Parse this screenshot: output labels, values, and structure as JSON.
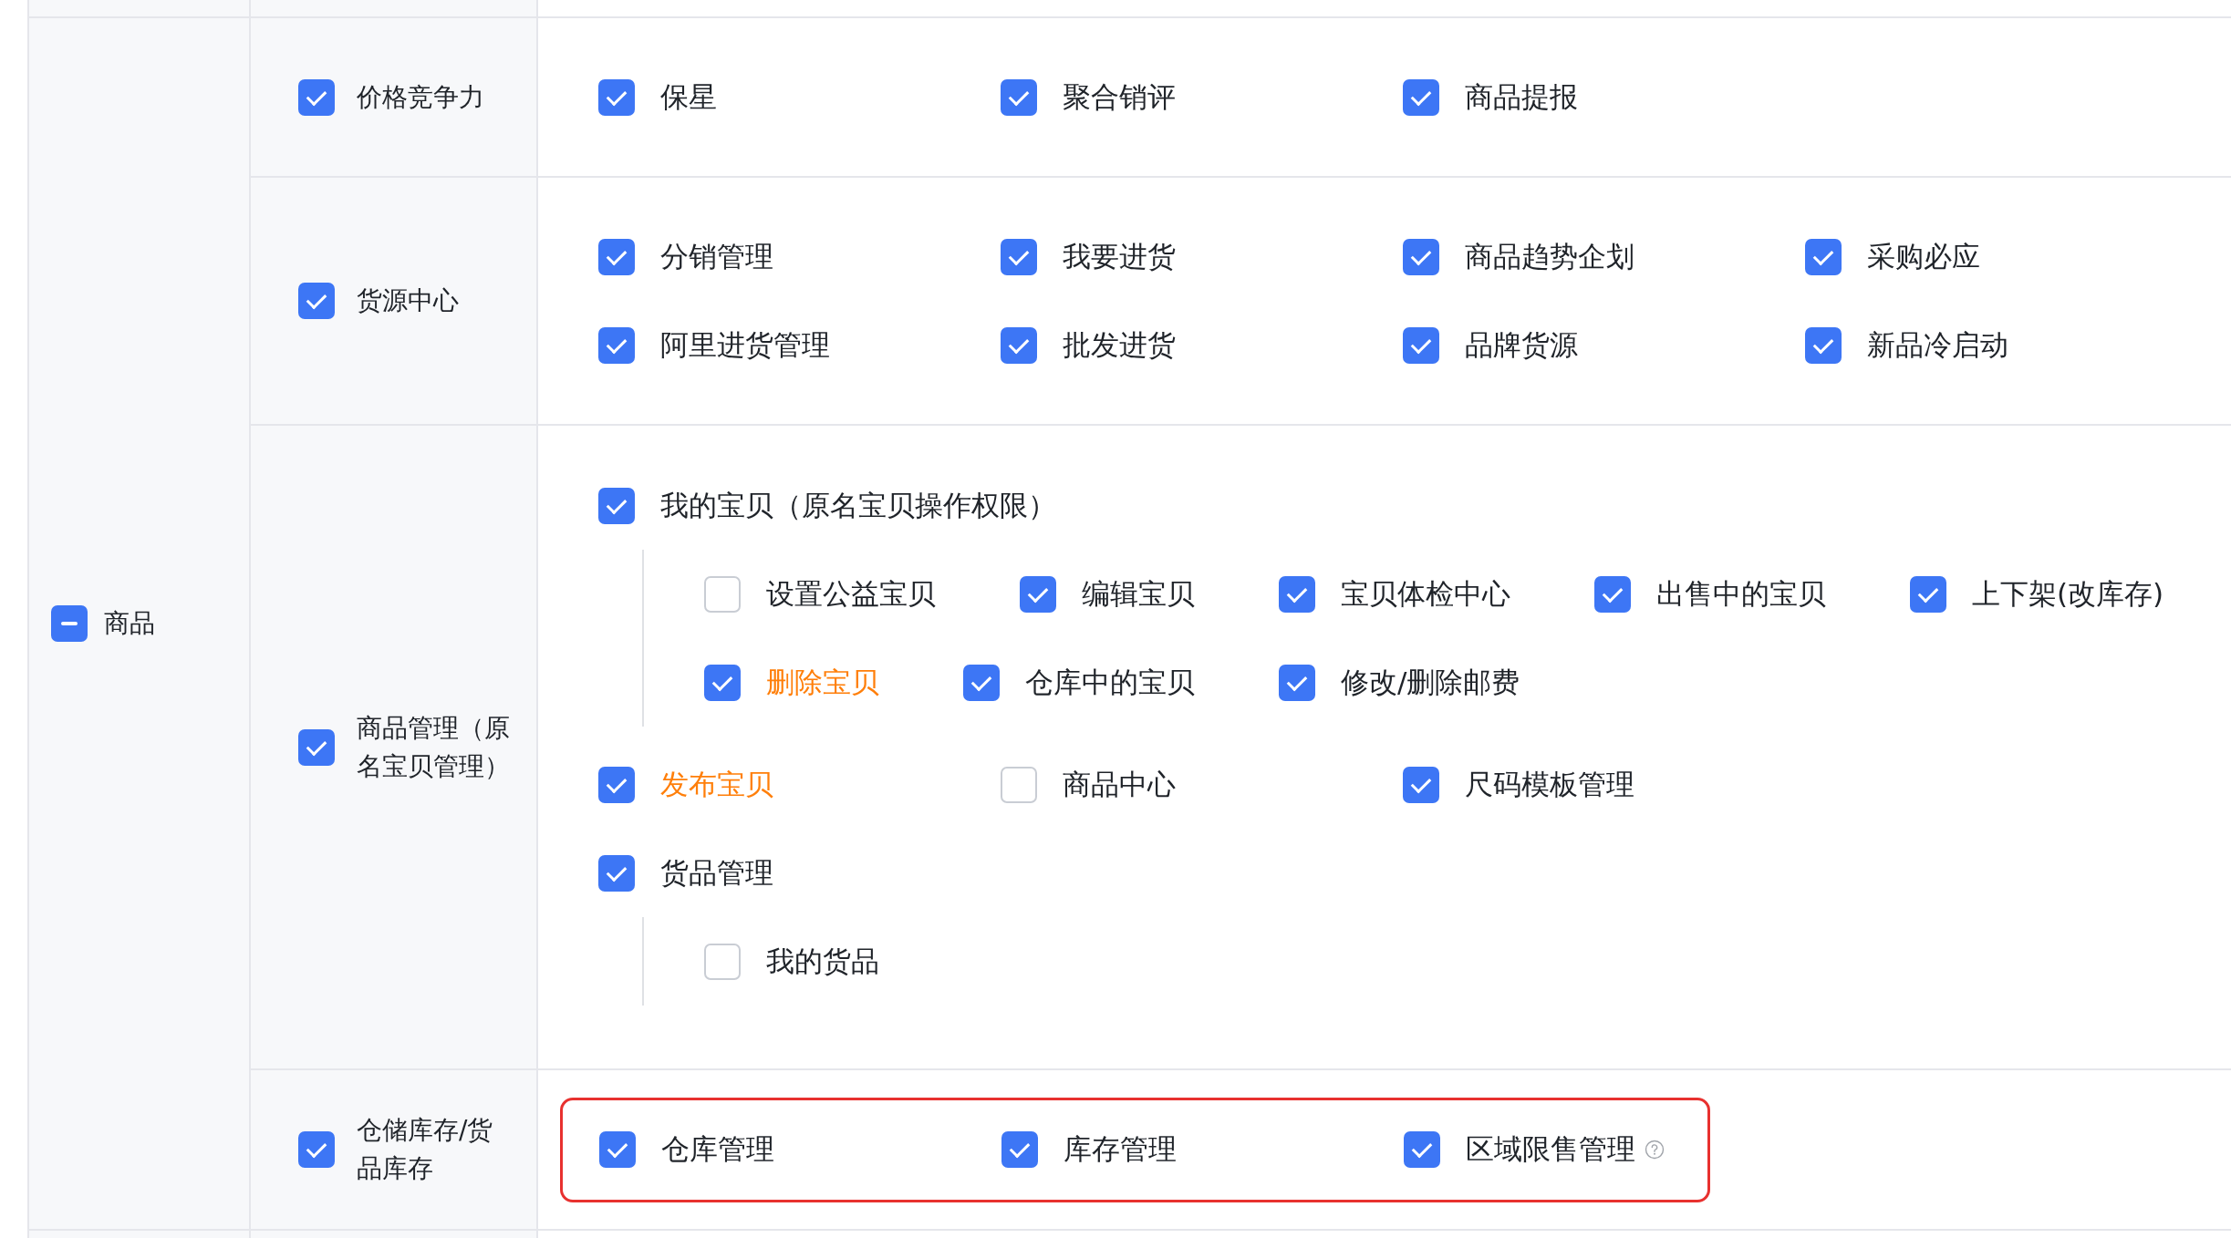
{
  "category": {
    "label": "商品",
    "indeterminate": true
  },
  "groups": [
    {
      "label": "价格竞争力",
      "checked": true,
      "outlined": false,
      "items": [
        {
          "label": "保星",
          "checked": true,
          "highlighted": false,
          "help": false
        },
        {
          "label": "聚合销评",
          "checked": true,
          "highlighted": false,
          "help": false
        },
        {
          "label": "商品提报",
          "checked": true,
          "highlighted": false,
          "help": false
        }
      ]
    },
    {
      "label": "货源中心",
      "checked": true,
      "outlined": false,
      "items": [
        {
          "label": "分销管理",
          "checked": true,
          "highlighted": false,
          "help": false
        },
        {
          "label": "我要进货",
          "checked": true,
          "highlighted": false,
          "help": false
        },
        {
          "label": "商品趋势企划",
          "checked": true,
          "highlighted": false,
          "help": false
        },
        {
          "label": "采购必应",
          "checked": true,
          "highlighted": false,
          "help": false
        },
        {
          "label": "阿里进货管理",
          "checked": true,
          "highlighted": false,
          "help": false
        },
        {
          "label": "批发进货",
          "checked": true,
          "highlighted": false,
          "help": false
        },
        {
          "label": "品牌货源",
          "checked": true,
          "highlighted": false,
          "help": false
        },
        {
          "label": "新品冷启动",
          "checked": true,
          "highlighted": false,
          "help": false
        }
      ]
    },
    {
      "label": "商品管理（原名宝贝管理）",
      "checked": true,
      "outlined": false,
      "items": [
        {
          "label": "我的宝贝（原名宝贝操作权限）",
          "checked": true,
          "highlighted": false,
          "help": false,
          "children": [
            {
              "label": "设置公益宝贝",
              "checked": false,
              "highlighted": false,
              "help": false
            },
            {
              "label": "编辑宝贝",
              "checked": true,
              "highlighted": false,
              "help": false
            },
            {
              "label": "宝贝体检中心",
              "checked": true,
              "highlighted": false,
              "help": false
            },
            {
              "label": "出售中的宝贝",
              "checked": true,
              "highlighted": false,
              "help": false
            },
            {
              "label": "上下架(改库存)",
              "checked": true,
              "highlighted": false,
              "help": false
            },
            {
              "label": "删除宝贝",
              "checked": true,
              "highlighted": true,
              "help": false
            },
            {
              "label": "仓库中的宝贝",
              "checked": true,
              "highlighted": false,
              "help": false
            },
            {
              "label": "修改/删除邮费",
              "checked": true,
              "highlighted": false,
              "help": false
            }
          ]
        },
        {
          "label": "发布宝贝",
          "checked": true,
          "highlighted": true,
          "help": false
        },
        {
          "label": "商品中心",
          "checked": false,
          "highlighted": false,
          "help": false
        },
        {
          "label": "尺码模板管理",
          "checked": true,
          "highlighted": false,
          "help": false
        },
        {
          "label": "货品管理",
          "checked": true,
          "highlighted": false,
          "help": false,
          "children": [
            {
              "label": "我的货品",
              "checked": false,
              "highlighted": false,
              "help": false
            }
          ]
        }
      ]
    },
    {
      "label": "仓储库存/货品库存",
      "checked": true,
      "outlined": true,
      "items": [
        {
          "label": "仓库管理",
          "checked": true,
          "highlighted": false,
          "help": false
        },
        {
          "label": "库存管理",
          "checked": true,
          "highlighted": false,
          "help": false
        },
        {
          "label": "区域限售管理",
          "checked": true,
          "highlighted": false,
          "help": true
        }
      ]
    }
  ]
}
